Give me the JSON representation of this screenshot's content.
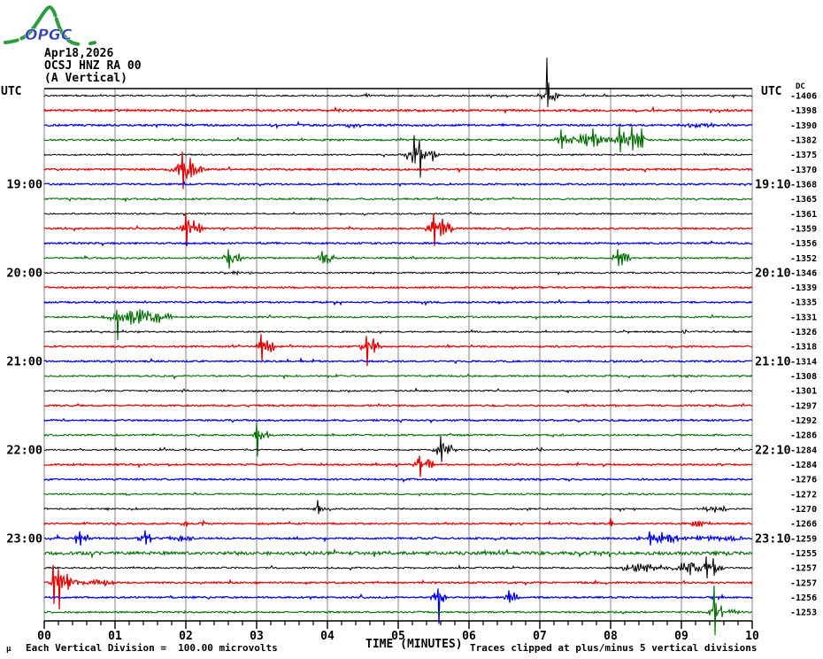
{
  "header": {
    "logo_text": "OPGC",
    "date": "Apr18,2026",
    "station": "OCSJ HNZ RA 00",
    "component": "(A Vertical)"
  },
  "labels": {
    "utc_left": "UTC",
    "utc_right": "UTC",
    "dc_header": "DC",
    "time_axis_title": "TIME (MINUTES)",
    "footer_symbol": "μ",
    "footer_left": "Each Vertical Division =  100.00 microvolts",
    "footer_right": "Traces clipped at plus/minus 5 vertical divisions"
  },
  "colors": {
    "black": "#000000",
    "red": "#e80000",
    "blue": "#0000e8",
    "green": "#006e00",
    "grid": "#808080",
    "logo_green": "#2e9b3e",
    "logo_blue": "#3344bb"
  },
  "chart_data": {
    "type": "line",
    "description": "Helicorder drum plot, 36 traces of 10 minutes each, 18:00-24:00 UTC",
    "x_axis": {
      "label": "TIME (MINUTES)",
      "min": 0,
      "max": 10,
      "tick_labels": [
        "00",
        "01",
        "02",
        "03",
        "04",
        "05",
        "06",
        "07",
        "08",
        "09",
        "10"
      ],
      "minor_ticks_per_minute": 5
    },
    "rows": [
      {
        "start": "18:00",
        "color": "black",
        "dc": "-1406",
        "noise": 0.8,
        "events": [
          [
            4.5,
            4.62,
            2
          ],
          [
            6.95,
            7.3,
            5
          ]
        ],
        "spikes": [
          [
            7.1,
            43,
            13
          ]
        ]
      },
      {
        "start": "18:10",
        "color": "red",
        "dc": "-1398",
        "noise": 1.1,
        "events": [
          [
            4.05,
            4.2,
            2
          ],
          [
            5.25,
            5.45,
            2
          ]
        ],
        "spikes": []
      },
      {
        "start": "18:20",
        "color": "blue",
        "dc": "-1390",
        "noise": 1.0,
        "events": [
          [
            4.2,
            4.45,
            2.2
          ],
          [
            8.95,
            9.55,
            2.2
          ]
        ],
        "spikes": []
      },
      {
        "start": "18:30",
        "color": "green",
        "dc": "-1382",
        "noise": 1.0,
        "events": [
          [
            7.15,
            8.1,
            6
          ],
          [
            8.05,
            8.5,
            8
          ]
        ],
        "spikes": [
          [
            7.3,
            12,
            10
          ],
          [
            7.75,
            13,
            8
          ],
          [
            8.12,
            16,
            14
          ],
          [
            8.3,
            15,
            12
          ],
          [
            8.44,
            13,
            9
          ]
        ]
      },
      {
        "start": "18:40",
        "color": "black",
        "dc": "-1375",
        "noise": 0.8,
        "events": [
          [
            5.08,
            5.6,
            8
          ]
        ],
        "spikes": [
          [
            5.22,
            22,
            10
          ],
          [
            5.3,
            16,
            26
          ]
        ]
      },
      {
        "start": "18:50",
        "color": "red",
        "dc": "-1370",
        "noise": 1.0,
        "events": [
          [
            1.82,
            2.3,
            8
          ]
        ],
        "spikes": [
          [
            1.95,
            20,
            22
          ],
          [
            2.06,
            13,
            9
          ]
        ]
      },
      {
        "start": "19:00",
        "color": "blue",
        "dc": "-1368",
        "noise": 0.9,
        "events": [],
        "spikes": [],
        "left_label": "19:00",
        "right_label": "19:10"
      },
      {
        "start": "19:10",
        "color": "green",
        "dc": "-1365",
        "noise": 0.9,
        "events": [],
        "spikes": []
      },
      {
        "start": "19:20",
        "color": "black",
        "dc": "-1361",
        "noise": 0.8,
        "events": [],
        "spikes": []
      },
      {
        "start": "19:30",
        "color": "red",
        "dc": "-1359",
        "noise": 0.9,
        "events": [
          [
            1.92,
            2.25,
            7
          ],
          [
            5.38,
            5.8,
            7
          ]
        ],
        "spikes": [
          [
            2.0,
            18,
            20
          ],
          [
            5.5,
            17,
            20
          ],
          [
            5.62,
            11,
            7
          ]
        ]
      },
      {
        "start": "19:40",
        "color": "blue",
        "dc": "-1356",
        "noise": 0.9,
        "events": [],
        "spikes": []
      },
      {
        "start": "19:50",
        "color": "green",
        "dc": "-1352",
        "noise": 0.9,
        "events": [
          [
            2.52,
            2.8,
            6
          ],
          [
            3.85,
            4.1,
            5
          ],
          [
            8.02,
            8.3,
            6
          ]
        ],
        "spikes": [
          [
            2.6,
            10,
            12
          ],
          [
            3.92,
            8,
            6
          ],
          [
            8.1,
            10,
            9
          ]
        ]
      },
      {
        "start": "20:00",
        "color": "black",
        "dc": "-1346",
        "noise": 0.8,
        "events": [
          [
            2.4,
            3.0,
            1.6
          ]
        ],
        "spikes": [],
        "left_label": "20:00",
        "right_label": "20:10"
      },
      {
        "start": "20:10",
        "color": "red",
        "dc": "-1339",
        "noise": 0.9,
        "events": [],
        "spikes": []
      },
      {
        "start": "20:20",
        "color": "blue",
        "dc": "-1335",
        "noise": 0.9,
        "events": [],
        "spikes": []
      },
      {
        "start": "20:30",
        "color": "green",
        "dc": "-1331",
        "noise": 0.9,
        "events": [
          [
            0.78,
            1.85,
            6
          ]
        ],
        "spikes": [
          [
            1.03,
            8,
            26
          ],
          [
            1.35,
            9,
            5
          ]
        ]
      },
      {
        "start": "20:40",
        "color": "black",
        "dc": "-1326",
        "noise": 0.8,
        "events": [
          [
            9.0,
            9.08,
            2
          ]
        ],
        "spikes": []
      },
      {
        "start": "20:50",
        "color": "red",
        "dc": "-1318",
        "noise": 0.9,
        "events": [
          [
            2.98,
            3.28,
            6
          ],
          [
            4.42,
            4.78,
            6
          ]
        ],
        "spikes": [
          [
            3.06,
            14,
            16
          ],
          [
            4.55,
            12,
            22
          ],
          [
            4.65,
            9,
            7
          ]
        ]
      },
      {
        "start": "21:00",
        "color": "blue",
        "dc": "-1314",
        "noise": 0.9,
        "events": [],
        "spikes": [],
        "left_label": "21:00",
        "right_label": "21:10"
      },
      {
        "start": "21:10",
        "color": "green",
        "dc": "-1308",
        "noise": 0.9,
        "events": [
          [
            8.98,
            9.1,
            2.5
          ]
        ],
        "spikes": []
      },
      {
        "start": "21:20",
        "color": "black",
        "dc": "-1301",
        "noise": 0.8,
        "events": [],
        "spikes": []
      },
      {
        "start": "21:30",
        "color": "red",
        "dc": "-1297",
        "noise": 0.9,
        "events": [],
        "spikes": []
      },
      {
        "start": "21:40",
        "color": "blue",
        "dc": "-1292",
        "noise": 0.9,
        "events": [],
        "spikes": []
      },
      {
        "start": "21:50",
        "color": "green",
        "dc": "-1286",
        "noise": 0.9,
        "events": [
          [
            2.92,
            3.2,
            6
          ]
        ],
        "spikes": [
          [
            3.0,
            14,
            24
          ]
        ]
      },
      {
        "start": "22:00",
        "color": "black",
        "dc": "-1284",
        "noise": 0.8,
        "events": [
          [
            5.48,
            5.82,
            6
          ],
          [
            9.72,
            9.88,
            2.5
          ]
        ],
        "spikes": [
          [
            5.6,
            16,
            14
          ]
        ],
        "left_label": "22:00",
        "right_label": "22:10"
      },
      {
        "start": "22:10",
        "color": "red",
        "dc": "-1284",
        "noise": 0.9,
        "events": [
          [
            5.18,
            5.52,
            6
          ]
        ],
        "spikes": [
          [
            5.3,
            10,
            14
          ]
        ]
      },
      {
        "start": "22:20",
        "color": "blue",
        "dc": "-1276",
        "noise": 0.9,
        "events": [],
        "spikes": []
      },
      {
        "start": "22:30",
        "color": "green",
        "dc": "-1272",
        "noise": 0.9,
        "events": [],
        "spikes": []
      },
      {
        "start": "22:40",
        "color": "black",
        "dc": "-1270",
        "noise": 0.8,
        "events": [
          [
            3.78,
            3.98,
            3.5
          ],
          [
            9.28,
            9.68,
            3
          ]
        ],
        "spikes": [
          [
            3.86,
            10,
            6
          ]
        ]
      },
      {
        "start": "22:50",
        "color": "red",
        "dc": "-1266",
        "noise": 0.9,
        "events": [
          [
            1.92,
            2.06,
            2.2
          ],
          [
            2.16,
            2.3,
            2.2
          ],
          [
            9.12,
            9.38,
            3
          ]
        ],
        "spikes": [
          [
            8.0,
            6,
            3
          ]
        ]
      },
      {
        "start": "23:00",
        "color": "blue",
        "dc": "-1259",
        "noise": 1.0,
        "events": [
          [
            0.38,
            0.66,
            4.5
          ],
          [
            1.28,
            1.56,
            4.5
          ],
          [
            1.72,
            2.12,
            2.5
          ],
          [
            8.35,
            9.0,
            5.5
          ],
          [
            9.0,
            9.98,
            2
          ]
        ],
        "spikes": [
          [
            0.5,
            8,
            8
          ],
          [
            1.42,
            9,
            7
          ],
          [
            8.55,
            8,
            8
          ]
        ],
        "left_label": "23:00",
        "right_label": "23:10"
      },
      {
        "start": "23:10",
        "color": "green",
        "dc": "-1255",
        "noise": 1.8,
        "events": [],
        "spikes": []
      },
      {
        "start": "23:20",
        "color": "black",
        "dc": "-1257",
        "noise": 0.9,
        "events": [
          [
            3.5,
            3.62,
            2
          ],
          [
            8.08,
            8.85,
            3.5
          ],
          [
            8.85,
            9.62,
            6
          ]
        ],
        "spikes": [
          [
            9.35,
            13,
            12
          ],
          [
            9.45,
            11,
            9
          ]
        ]
      },
      {
        "start": "23:30",
        "color": "red",
        "dc": "-1257",
        "noise": 0.9,
        "events": [
          [
            0.04,
            0.5,
            8
          ],
          [
            0.5,
            1.0,
            3
          ]
        ],
        "spikes": [
          [
            0.12,
            20,
            24
          ],
          [
            0.2,
            15,
            30
          ],
          [
            0.32,
            10,
            8
          ]
        ]
      },
      {
        "start": "23:40",
        "color": "blue",
        "dc": "-1256",
        "noise": 0.9,
        "events": [
          [
            5.44,
            5.72,
            5
          ],
          [
            6.48,
            6.72,
            4.5
          ]
        ],
        "spikes": [
          [
            5.56,
            10,
            30
          ],
          [
            6.56,
            8,
            6
          ]
        ]
      },
      {
        "start": "23:50",
        "color": "green",
        "dc": "-1253",
        "noise": 0.9,
        "events": [
          [
            9.36,
            9.62,
            7
          ],
          [
            9.62,
            9.88,
            2.5
          ]
        ],
        "spikes": [
          [
            9.46,
            30,
            26
          ]
        ]
      }
    ]
  }
}
